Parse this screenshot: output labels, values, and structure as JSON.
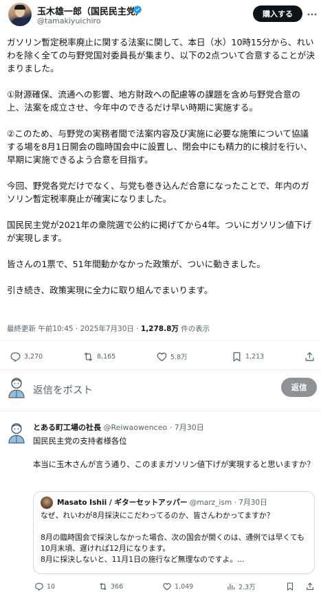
{
  "header": {
    "author_name": "玉木雄一郎（国民民主党）",
    "author_handle": "@tamakiyuichiro",
    "buy_button": "購入する",
    "verified_color": "#1d9bf0"
  },
  "post": {
    "paragraphs": [
      "ガソリン暫定税率廃止に関する法案に関して、本日（水）10時15分から、れいわを除く全ての与野党国対委員長が集まり、以下の2点ついて合意することが決まりました。",
      "①財源確保、流通への影響、地方財政への配慮等の課題を含め与野党合意の上、法案を成立させ、今年中のできるだけ早い時期に実施する。",
      "②このため、与野党の実務者間で法案内容及び実施に必要な施策について協議する場を8月1日開会の臨時国会中に設置し、閉会中にも精力的に検討を行い、早期に実施できるよう合意を目指す。",
      "今回、野党各党だけでなく、与党も巻き込んだ合意になったことで、年内のガソリン暫定税率廃止が確実になりました。",
      "国民民主党が2021年の衆院選で公約に掲げてから4年。ついにガソリン値下げが実現します。",
      "皆さんの1票で、51年間動かなかった政策が、ついに動きました。",
      "引き続き、政策実現に全力に取り組んでまいります。"
    ],
    "meta_prefix": "最終更新 午前10:45 · 2025年7月30日 · ",
    "views": "1,278.8万",
    "views_suffix": " 件の表示"
  },
  "actions": {
    "replies": "3,270",
    "reposts": "8,165",
    "likes": "5.8万",
    "bookmarks": "1,213"
  },
  "reply_box": {
    "placeholder": "返信をポスト",
    "button": "返信"
  },
  "reply": {
    "author_name": "とある町工場の社長",
    "handle_date": "@Reiwaowenceo · 7月30日",
    "line1": "国民民主党の支持者様各位",
    "line2": "本当に玉木さんが言う通り、このままガソリン値下げが実現すると思いますか？",
    "quote": {
      "author_name": "Masato Ishii / ギターセットアッパー",
      "handle_date": "@marz_ism · 7月30日",
      "p1": "なぜ、れいわが8月採決にこだわってるのか、皆さんわかってますか？",
      "p2": "8月の臨時国会で採決しなかった場合、次の国会が開くのは、通例では早くても10月末頃、遅ければ12月になります。\n8月に採決しないと、11月1日の施行など無理なのですよ。..."
    },
    "actions": {
      "replies": "10",
      "reposts": "366",
      "likes": "1,049",
      "views": "2.3万"
    }
  }
}
